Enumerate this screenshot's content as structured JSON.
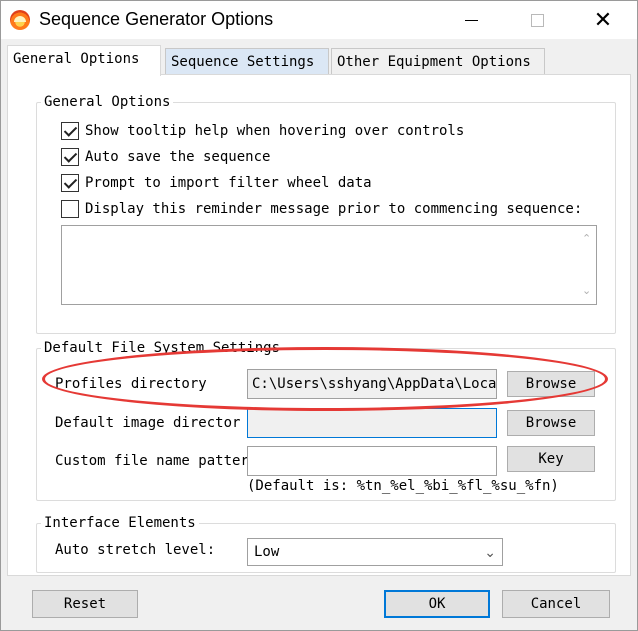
{
  "window": {
    "title": "Sequence Generator Options",
    "close_glyph": "✕"
  },
  "tabs": [
    {
      "label": "General Options"
    },
    {
      "label": "Sequence Settings"
    },
    {
      "label": "Other Equipment Options"
    }
  ],
  "general_options": {
    "title": "General Options",
    "checkboxes": [
      {
        "label": "Show tooltip help when hovering over controls",
        "checked": true
      },
      {
        "label": "Auto save the sequence",
        "checked": true
      },
      {
        "label": "Prompt to import filter wheel data",
        "checked": true
      },
      {
        "label": "Display this reminder message prior to commencing sequence:",
        "checked": false
      }
    ],
    "reminder_text": ""
  },
  "file_system": {
    "title": "Default File System Settings",
    "profiles_label": "Profiles directory",
    "profiles_value": "C:\\Users\\sshyang\\AppData\\Local",
    "image_dir_label": "Default image director",
    "image_dir_value": "",
    "pattern_label": "Custom file name pattern:",
    "pattern_value": "",
    "browse_label": "Browse",
    "key_label": "Key",
    "hint": "(Default is: %tn_%el_%bi_%fl_%su_%fn)"
  },
  "interface": {
    "title": "Interface Elements",
    "stretch_label": "Auto stretch level:",
    "stretch_value": "Low"
  },
  "footer": {
    "reset_label": "Reset",
    "ok_label": "OK",
    "cancel_label": "Cancel"
  },
  "colors": {
    "highlight_ellipse": "#e53935",
    "focus_accent": "#0078d7"
  },
  "icons": {
    "app": "sequence-generator-app-icon",
    "close": "close-icon",
    "minimize": "minimize-icon",
    "maximize": "maximize-icon",
    "dropdown": "chevron-down-icon"
  }
}
